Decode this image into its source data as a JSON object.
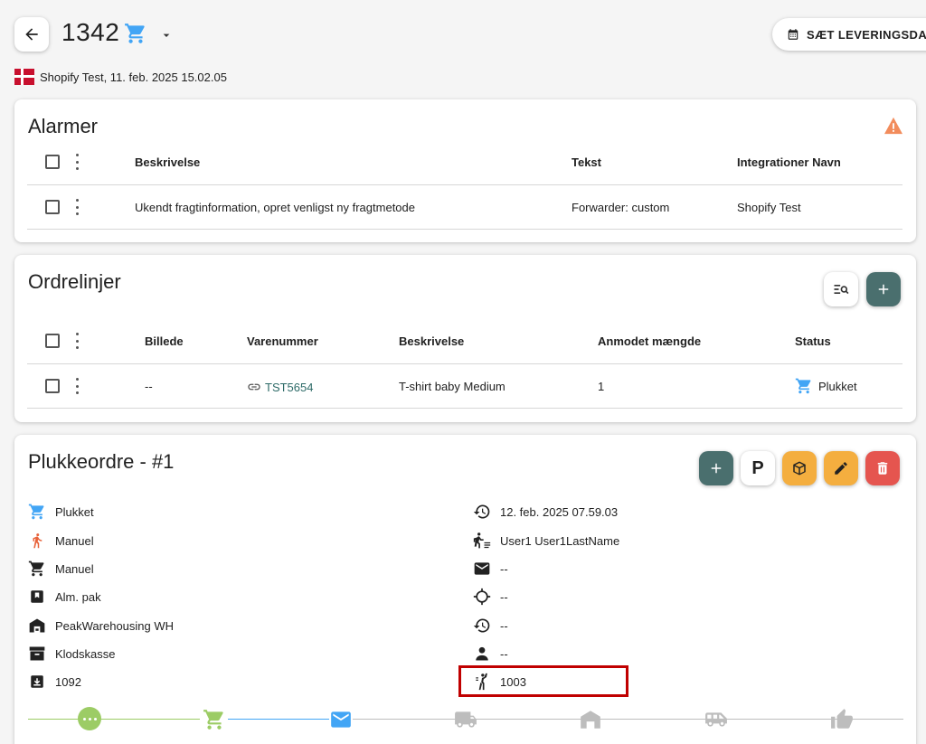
{
  "header": {
    "order_number": "1342",
    "delivery_button_label": "SÆT LEVERINGSDATO",
    "source_line": "Shopify Test, 11. feb. 2025 15.02.05"
  },
  "alarms": {
    "title": "Alarmer",
    "columns": [
      "Beskrivelse",
      "Tekst",
      "Integrationer Navn"
    ],
    "rows": [
      {
        "description": "Ukendt fragtinformation, opret venligst ny fragtmetode",
        "text": "Forwarder: custom",
        "integration": "Shopify Test"
      }
    ]
  },
  "orderlines": {
    "title": "Ordrelinjer",
    "columns": [
      "Billede",
      "Varenummer",
      "Beskrivelse",
      "Anmodet mængde",
      "Status"
    ],
    "rows": [
      {
        "image": "--",
        "sku": "TST5654",
        "description": "T-shirt baby Medium",
        "quantity": "1",
        "status": "Plukket"
      }
    ]
  },
  "pickorder": {
    "title": "Plukkeordre - #1",
    "p_button_label": "P",
    "left": [
      {
        "icon": "cart-blue-icon",
        "value": "Plukket"
      },
      {
        "icon": "walking-person-icon",
        "value": "Manuel"
      },
      {
        "icon": "cart-icon",
        "value": "Manuel"
      },
      {
        "icon": "package-box-icon",
        "value": "Alm. pak"
      },
      {
        "icon": "warehouse-icon",
        "value": "PeakWarehousing WH"
      },
      {
        "icon": "archive-box-icon",
        "value": "Klodskasse"
      },
      {
        "icon": "download-box-icon",
        "value": "1092"
      }
    ],
    "right": [
      {
        "icon": "history-icon",
        "value": "12. feb. 2025 07.59.03"
      },
      {
        "icon": "picker-person-icon",
        "value": "User1 User1LastName"
      },
      {
        "icon": "mail-icon",
        "value": "--"
      },
      {
        "icon": "crosshair-icon",
        "value": "--"
      },
      {
        "icon": "history-icon",
        "value": "--"
      },
      {
        "icon": "person-icon",
        "value": "--"
      },
      {
        "icon": "cheering-person-icon",
        "value": "1003"
      }
    ]
  },
  "colors": {
    "accent_teal": "#4a6f6e",
    "orange": "#f4ae3f",
    "red": "#e5554f",
    "cart_blue": "#42a5f5",
    "alert_orange": "#f28c5c",
    "stepper_green": "#9ccc65"
  }
}
